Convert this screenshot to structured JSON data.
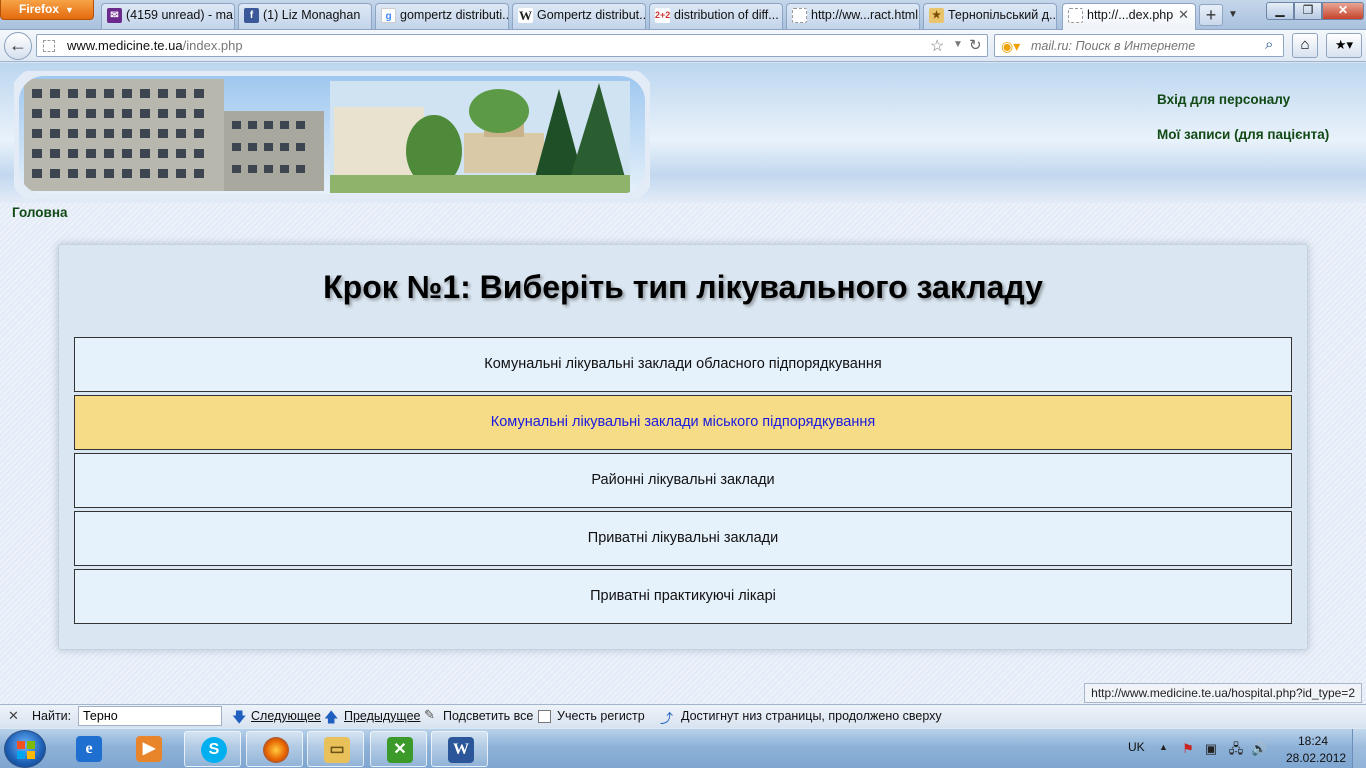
{
  "browser": {
    "menu_button": "Firefox",
    "tabs": [
      {
        "label": "(4159 unread) - ma...",
        "icon": "yahoo-mail-icon",
        "color": "#6b2a8c"
      },
      {
        "label": "(1) Liz Monaghan",
        "icon": "facebook-icon",
        "color": "#3b5998"
      },
      {
        "label": "gompertz distributi...",
        "icon": "google-icon",
        "color": "#4285f4"
      },
      {
        "label": "Gompertz distribut...",
        "icon": "wikipedia-icon",
        "color": "#555555"
      },
      {
        "label": "distribution of diff...",
        "icon": "page-icon-2plus2",
        "color": "#cc3333"
      },
      {
        "label": "http://ww...ract.html",
        "icon": "blank-page-icon",
        "color": "#cccccc"
      },
      {
        "label": "Тернопільський д...",
        "icon": "site-icon",
        "color": "#d89b2b"
      },
      {
        "label": "http://...dex.php",
        "icon": "blank-page-icon",
        "color": "#cccccc"
      }
    ],
    "url_domain": "www.medicine.te.ua",
    "url_path": "/index.php",
    "search_placeholder": "mail.ru: Поиск в Интернете"
  },
  "page": {
    "top_links": {
      "staff_login": "Вхід для персоналу",
      "my_records": "Мої записи (для пацієнта)"
    },
    "breadcrumb_home": "Головна",
    "step_title": "Крок №1: Виберіть тип лікувального закладу",
    "options": [
      {
        "label": "Комунальні лікувальні заклади обласного підпорядкування",
        "state": "normal"
      },
      {
        "label": "Комунальні лікувальні заклади міського підпорядкування",
        "state": "hover"
      },
      {
        "label": "Районні лікувальні заклади",
        "state": "normal"
      },
      {
        "label": "Приватні лікувальні заклади",
        "state": "normal"
      },
      {
        "label": "Приватні практикуючі лікарі",
        "state": "normal"
      }
    ],
    "status_url": "http://www.medicine.te.ua/hospital.php?id_type=2"
  },
  "findbar": {
    "label": "Найти:",
    "query": "Терно",
    "next": "Следующее",
    "previous": "Предыдущее",
    "highlight_all": "Подсветить все",
    "match_case": "Учесть регистр",
    "wrap_status": "Достигнут низ страницы, продолжено сверху"
  },
  "taskbar": {
    "apps": [
      {
        "name": "internet-explorer-icon",
        "letter": "e",
        "color": "#1f6fd1",
        "open": false
      },
      {
        "name": "media-player-icon",
        "letter": "▶",
        "color": "#e8842a",
        "open": false
      },
      {
        "name": "skype-icon",
        "letter": "S",
        "color": "#00aff0",
        "open": true
      },
      {
        "name": "firefox-icon",
        "letter": "●",
        "color": "#e66000",
        "open": true
      },
      {
        "name": "file-explorer-icon",
        "letter": "▭",
        "color": "#e8c15a",
        "open": true
      },
      {
        "name": "green-app-icon",
        "letter": "✕",
        "color": "#3c9a2a",
        "open": true
      },
      {
        "name": "word-icon",
        "letter": "W",
        "color": "#2b579a",
        "open": true
      }
    ],
    "language": "UK",
    "time": "18:24",
    "date": "28.02.2012"
  }
}
